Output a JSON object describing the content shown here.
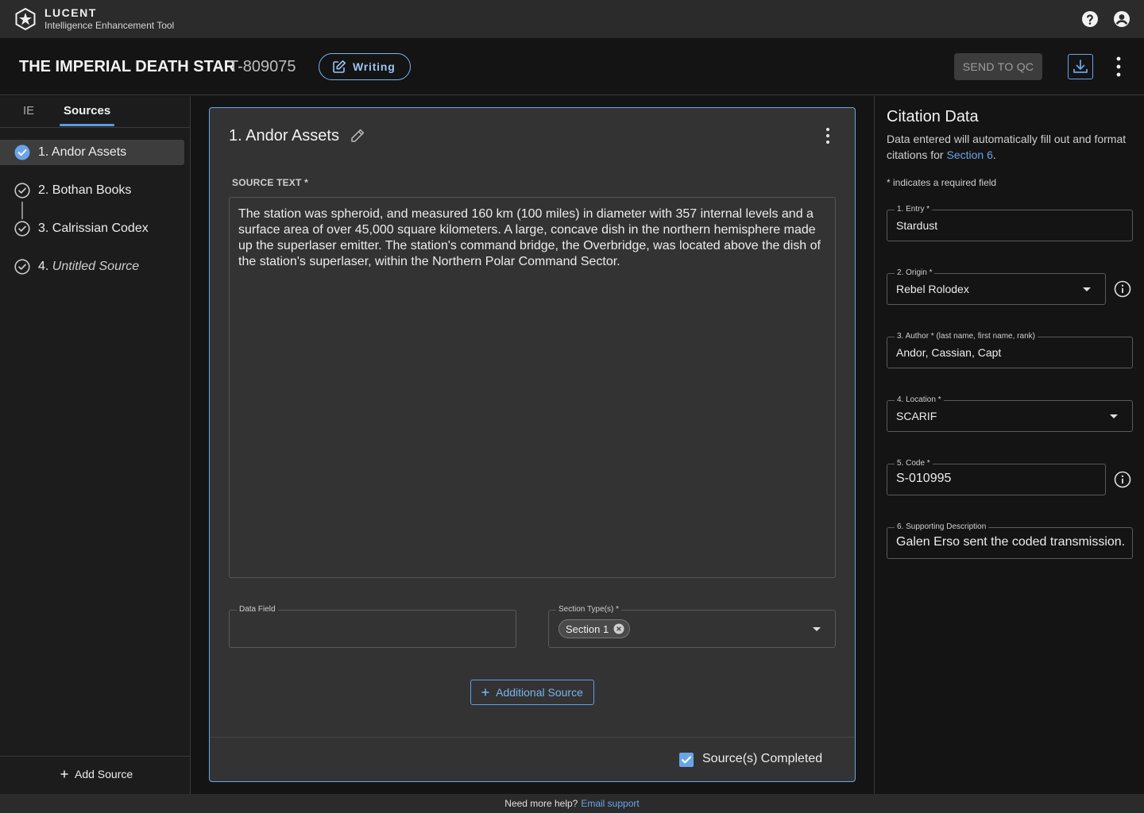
{
  "app": {
    "brand_name": "LUCENT",
    "brand_subtitle": "Intelligence Enhancement Tool",
    "icons": {
      "help": "help-circle-icon",
      "account": "account-circle-icon",
      "logo": "hex-star-logo-icon"
    }
  },
  "header": {
    "title": "THE IMPERIAL DEATH STAR",
    "doc_id": "T-809075",
    "status_label": "Writing",
    "send_qc_label": "SEND TO QC",
    "accent_color": "#6aa4e8"
  },
  "sidebar": {
    "tabs": [
      {
        "label": "IE",
        "active": false
      },
      {
        "label": "Sources",
        "active": true
      }
    ],
    "items": [
      {
        "label": "1. Andor Assets",
        "status": "checked-filled",
        "active": true,
        "italic": false
      },
      {
        "label": "2. Bothan Books",
        "status": "checked-outline",
        "active": false,
        "italic": false
      },
      {
        "label": "3. Calrissian Codex",
        "status": "checked-outline",
        "active": false,
        "italic": false
      },
      {
        "label": "4. ",
        "label_italic": "Untitled Source",
        "status": "checked-outline",
        "active": false,
        "italic": true
      }
    ],
    "add_source_label": "Add Source"
  },
  "card": {
    "title": "1. Andor Assets",
    "source_text_label": "SOURCE TEXT *",
    "source_text": "The station was spheroid, and measured 160 km (100 miles) in diameter with 357 internal levels and a surface area of over 45,000 square kilometers. A large, concave dish in the northern hemisphere made up the superlaser emitter. The station's command bridge, the Overbridge, was located above the dish of the station's superlaser, within the Northern Polar Command Sector.",
    "data_field_label": "Data Field",
    "data_field_value": "",
    "section_types_label": "Section Type(s) *",
    "section_chips": [
      "Section 1"
    ],
    "additional_source_label": "Additional Source",
    "completed_label": "Source(s) Completed",
    "completed_checked": true
  },
  "citation": {
    "title": "Citation Data",
    "desc_prefix": "Data entered will automatically fill out and format citations for ",
    "desc_link": "Section 6",
    "desc_suffix": ".",
    "required_note": "* indicates a required field",
    "fields": [
      {
        "label": "1. Entry *",
        "value": "Stardust"
      },
      {
        "label": "2. Origin *",
        "value": "Rebel Rolodex"
      },
      {
        "label": "3. Author * (last name, first name, rank)",
        "value": "Andor, Cassian, Capt"
      },
      {
        "label": "4. Location *",
        "value": "SCARIF"
      },
      {
        "label": "5. Code *",
        "value": "S-010995"
      },
      {
        "label": "6. Supporting Description",
        "value": "Galen Erso sent the coded transmission."
      }
    ]
  },
  "footer": {
    "help_text": "Need more help?",
    "link_text": "Email support"
  }
}
